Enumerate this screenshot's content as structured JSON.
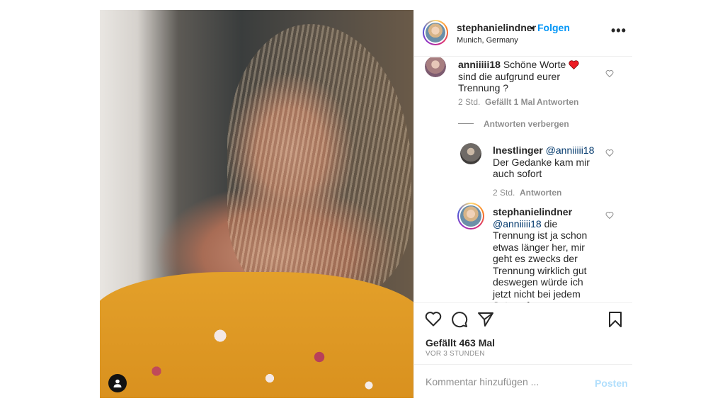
{
  "header": {
    "username": "stephanielindner",
    "separator": "•",
    "follow_label": "Folgen",
    "location": "Munich, Germany",
    "more_label": "•••"
  },
  "comments": [
    {
      "user": "anniiiii18",
      "text_before": "Schöne Worte",
      "emoji": "red-heart",
      "text_after": "sind die aufgrund eurer Trennung ?",
      "time": "2 Std.",
      "likes": "Gefällt 1 Mal",
      "reply_label": "Antworten"
    }
  ],
  "hide_replies_label": "Antworten verbergen",
  "replies": [
    {
      "user": "lnestlinger",
      "mention": "@anniiiii18",
      "text": "Der Gedanke kam mir auch sofort",
      "time": "2 Std.",
      "reply_label": "Antworten"
    },
    {
      "user": "stephanielindner",
      "mention": "@anniiiii18",
      "text": "die Trennung ist ja schon etwas länger her, mir geht es zwecks der Trennung wirklich gut deswegen würde ich jetzt nicht bei jedem Satz auf unsere Trennung setzen."
    }
  ],
  "actions": {
    "likes_text": "Gefällt 463 Mal",
    "time_text": "VOR 3 STUNDEN"
  },
  "add_comment": {
    "placeholder": "Kommentar hinzufügen ...",
    "post_label": "Posten"
  },
  "colors": {
    "link_blue": "#0095f6",
    "mention": "#00376b",
    "muted": "#8e8e8e",
    "post_disabled": "#b2dffc",
    "heart_emoji": "#ed4956"
  },
  "icons": [
    "heart-icon",
    "comment-icon",
    "share-icon",
    "bookmark-icon",
    "user-tag-icon",
    "more-icon"
  ]
}
